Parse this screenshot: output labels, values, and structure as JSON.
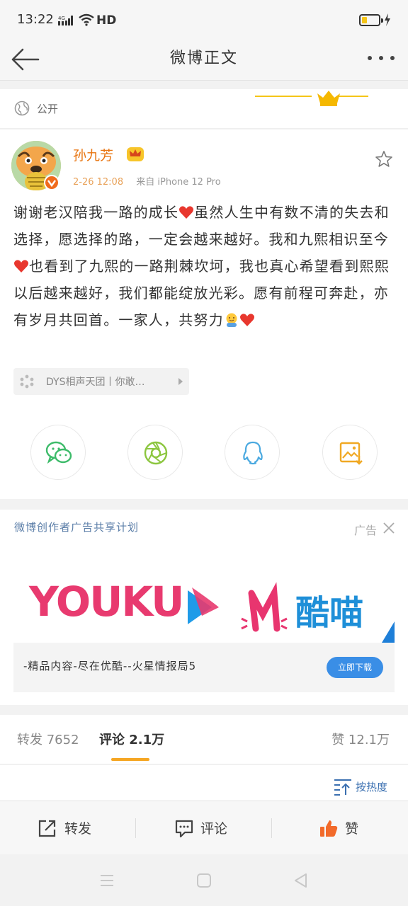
{
  "status_bar": {
    "time": "13:22",
    "network": "4G",
    "hd": "HD"
  },
  "nav": {
    "title": "微博正文"
  },
  "post": {
    "visibility": "公开",
    "username": "孙九芳",
    "time": "2-26 12:08",
    "source": "来自 iPhone 12 Pro",
    "content_parts": [
      "谢谢老汉陪我一路的成长",
      "虽然人生中有数不清的失去和选择，愿选择的路，一定会越来越好。我和九熙相识至今",
      "也看到了九熙的一路荆棘坎坷，我也真心希望看到熙熙以后越来越好，我们都能绽放光彩。愿有前程可奔赴，亦有岁月共回首。一家人，共努力"
    ],
    "topic": "DYS相声天团丨你敢…"
  },
  "share": {
    "items": [
      "wechat-icon",
      "moments-icon",
      "qq-icon",
      "save-image-icon"
    ]
  },
  "ad": {
    "title": "微博创作者广告共享计划",
    "tag": "广告",
    "brand1": "YOUKU",
    "brand2": "酷喵",
    "desc": "-精品内容-尽在优酷--火星情报局5",
    "button": "立即下载"
  },
  "tabs": {
    "repost": "转发 7652",
    "comment": "评论 2.1万",
    "like": "赞 12.1万"
  },
  "sort": {
    "label": "按热度"
  },
  "actions": {
    "repost": "转发",
    "comment": "评论",
    "like": "赞"
  },
  "colors": {
    "accent_orange": "#f5a623",
    "username": "#e8740f",
    "link_blue": "#5b7ea8"
  }
}
